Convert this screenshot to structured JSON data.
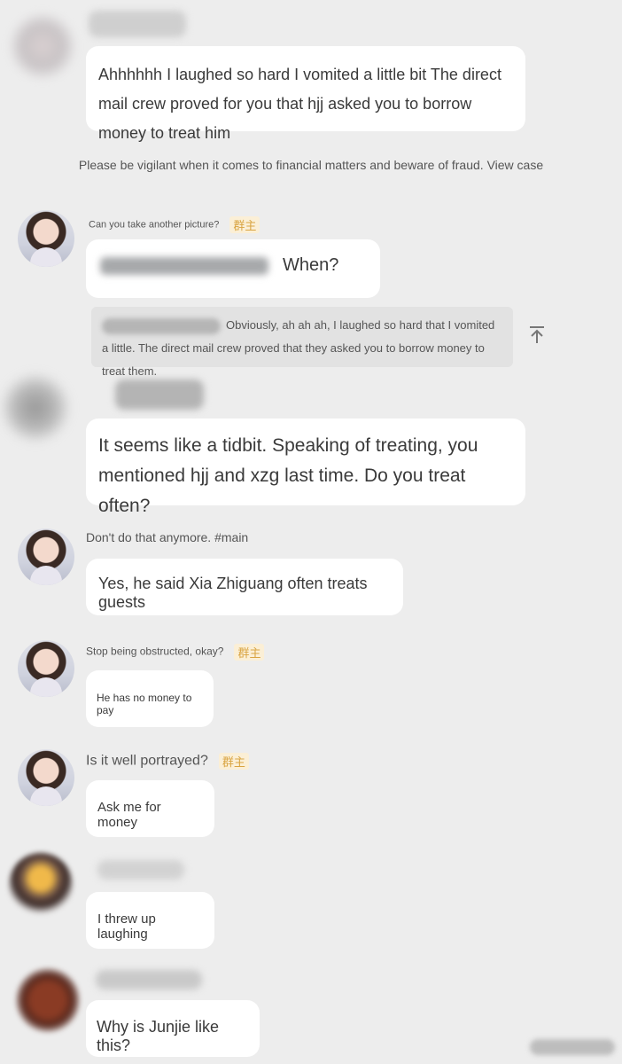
{
  "messages": {
    "m1": {
      "text": "Ahhhhhh I laughed so hard I vomited a little bit The direct mail crew proved for you that hjj asked you to borrow money to treat him"
    },
    "system_notice": "Please be vigilant when it comes to financial matters and beware of fraud. View case",
    "m2": {
      "name": "Can you take another picture?",
      "tag": "群主",
      "bubble_text": "When?",
      "quote_text": "Obviously, ah ah ah, I laughed so hard that I vomited a little. The direct mail crew proved that they asked you to borrow money to treat them."
    },
    "m3": {
      "text": "It seems like a tidbit. Speaking of treating, you mentioned hjj and xzg last time. Do you treat often?"
    },
    "m4": {
      "name": "Don't do that anymore. #main",
      "text": "Yes, he said Xia Zhiguang often treats guests"
    },
    "m5": {
      "name": "Stop being obstructed, okay?",
      "tag": "群主",
      "text": "He has no money to pay"
    },
    "m6": {
      "name": "Is it well portrayed?",
      "tag": "群主",
      "text": "Ask me for money"
    },
    "m7": {
      "text": "I threw up laughing"
    },
    "m8": {
      "text": "Why is Junjie like this?"
    }
  },
  "icons": {
    "pin": "pin-to-top-icon",
    "avatar_woman": "avatar",
    "blurred_avatar": "blurred-avatar"
  },
  "colors": {
    "background": "#ededed",
    "bubble": "#ffffff",
    "tag_text": "#d9a441",
    "tag_bg": "#fbefd6"
  }
}
